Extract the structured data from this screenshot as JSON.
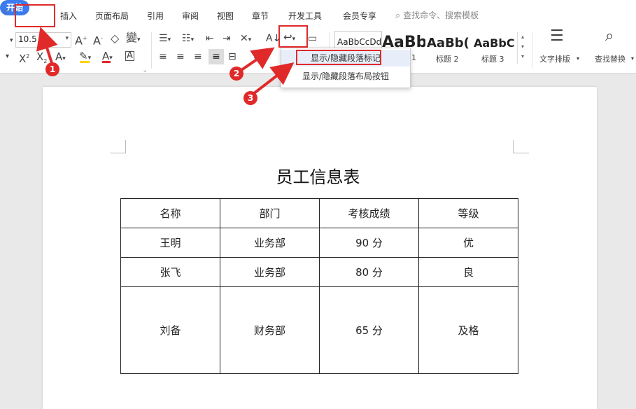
{
  "tabs": {
    "home": "开始",
    "items": [
      "插入",
      "页面布局",
      "引用",
      "审阅",
      "视图",
      "章节",
      "开发工具",
      "会员专享"
    ],
    "search_placeholder": "查找命令、搜索模板"
  },
  "ribbon": {
    "font_size": "10.5",
    "styles": [
      {
        "preview": "AaBbCcDd",
        "label": ""
      },
      {
        "preview": "AaBb",
        "label": "1"
      },
      {
        "preview": "AaBb(",
        "label": "标题 2"
      },
      {
        "preview": "AaBbC(",
        "label": "标题 3"
      }
    ],
    "text_layout_label": "文字排版",
    "find_replace_label": "查找替换",
    "accent": "#3a7bef",
    "font_color_bar": "#e02a2a",
    "highlight_color_bar": "#ffd400"
  },
  "dropdown": {
    "item1": "显示/隐藏段落标记",
    "item2": "显示/隐藏段落布局按钮"
  },
  "document": {
    "title": "员工信息表",
    "headers": [
      "名称",
      "部门",
      "考核成绩",
      "等级"
    ],
    "rows": [
      [
        "王明",
        "业务部",
        "90 分",
        "优"
      ],
      [
        "张飞",
        "业务部",
        "80 分",
        "良"
      ],
      [
        "刘备",
        "财务部",
        "65 分",
        "及格"
      ]
    ]
  },
  "annotations": {
    "badge1": "1",
    "badge2": "2",
    "badge3": "3",
    "color": "#e02a2a"
  }
}
